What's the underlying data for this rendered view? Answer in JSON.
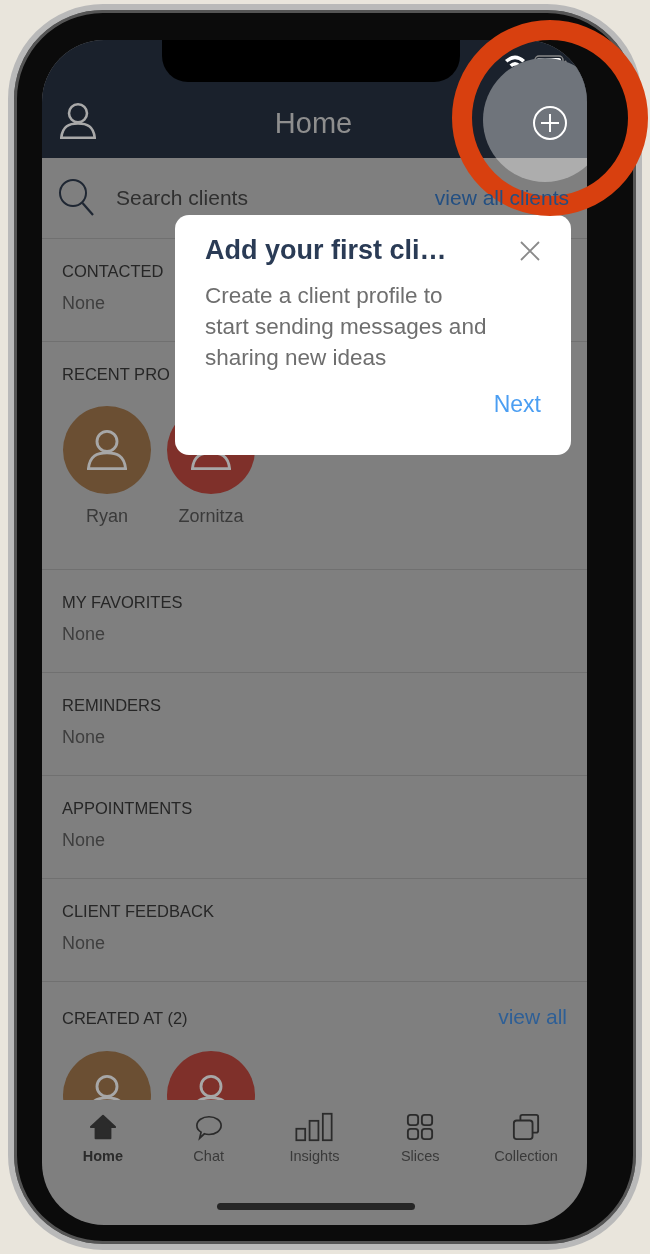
{
  "header": {
    "title": "Home"
  },
  "search": {
    "placeholder": "Search clients",
    "link": "view all clients"
  },
  "sections": [
    {
      "kind": "text",
      "title": "CONTACTED",
      "value": "None"
    },
    {
      "kind": "avatars",
      "title": "RECENT PRO",
      "people": [
        {
          "name": "Ryan",
          "color": "#6b4f33"
        },
        {
          "name": "Zornitza",
          "color": "#7f302a"
        }
      ]
    },
    {
      "kind": "text",
      "title": "MY FAVORITES",
      "value": "None"
    },
    {
      "kind": "text",
      "title": "REMINDERS",
      "value": "None"
    },
    {
      "kind": "text",
      "title": "APPOINTMENTS",
      "value": "None"
    },
    {
      "kind": "text",
      "title": "CLIENT FEEDBACK",
      "value": "None"
    },
    {
      "kind": "avatars",
      "title": "CREATED AT (2)",
      "link": "view all",
      "people": [
        {
          "color": "#6b4f33"
        },
        {
          "color": "#7f302a"
        }
      ]
    }
  ],
  "tooltip": {
    "title": "Add your first cli…",
    "body": "Create a client profile to start sending messages and sharing new ideas",
    "action": "Next"
  },
  "tabs": [
    {
      "kind": "home",
      "label": "Home",
      "selected": true
    },
    {
      "kind": "chat",
      "label": "Chat",
      "selected": false
    },
    {
      "kind": "insights",
      "label": "Insights",
      "selected": false
    },
    {
      "kind": "slices",
      "label": "Slices",
      "selected": false
    },
    {
      "kind": "collection",
      "label": "Collection",
      "selected": false
    }
  ]
}
